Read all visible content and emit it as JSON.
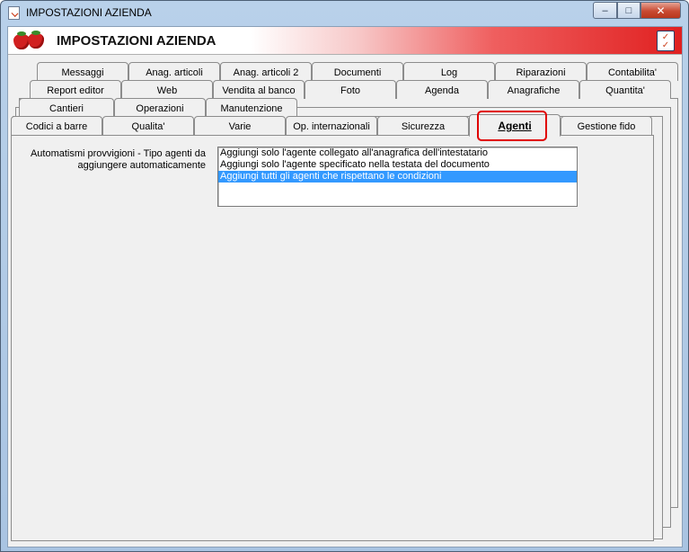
{
  "window": {
    "title": "IMPOSTAZIONI AZIENDA",
    "minimize_glyph": "–",
    "maximize_glyph": "□",
    "close_glyph": "✕"
  },
  "banner": {
    "title": "IMPOSTAZIONI AZIENDA",
    "logo": "strawberries-logo",
    "check_icon": "checklist-icon"
  },
  "tabs": {
    "row1": [
      "Messaggi",
      "Anag. articoli",
      "Anag. articoli 2",
      "Documenti",
      "Log",
      "Riparazioni",
      "Contabilita'"
    ],
    "row2": [
      "Report editor",
      "Web",
      "Vendita al banco",
      "Foto",
      "Agenda",
      "Anagrafiche",
      "Quantita'"
    ],
    "row3": [
      "Cantieri",
      "Operazioni",
      "Manutenzione"
    ],
    "row4": [
      "Codici a barre",
      "Qualita'",
      "Varie",
      "Op. internazionali",
      "Sicurezza",
      "Agenti",
      "Gestione fido"
    ],
    "active": "Agenti"
  },
  "agenti": {
    "label": "Automatismi provvigioni - Tipo agenti da aggiungere automaticamente",
    "options": [
      "Aggiungi solo l'agente collegato all'anagrafica dell'intestatario",
      "Aggiungi solo l'agente specificato nella testata del documento",
      "Aggiungi tutti gli agenti che rispettano le condizioni"
    ],
    "selected_index": 2
  },
  "colors": {
    "selection": "#3399ff",
    "highlight_border": "#e00000",
    "banner_red": "#e02020"
  }
}
